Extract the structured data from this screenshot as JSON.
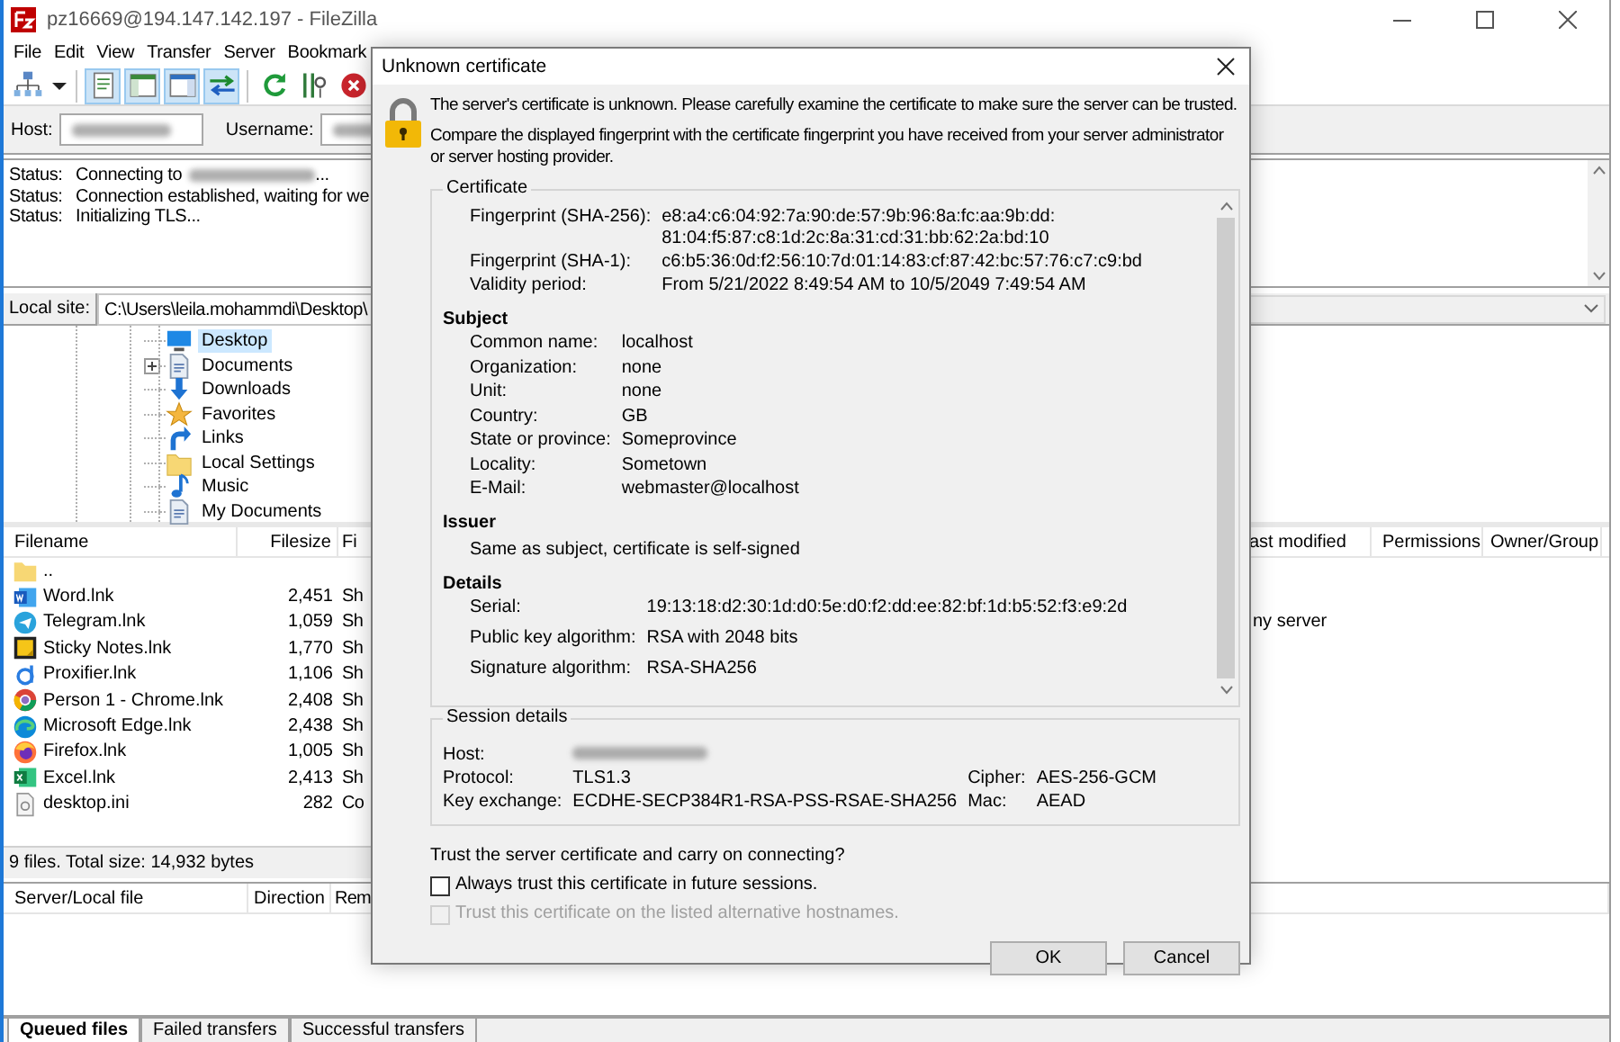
{
  "window": {
    "title": "pz16669@194.147.142.197 - FileZilla"
  },
  "menu": [
    "File",
    "Edit",
    "View",
    "Transfer",
    "Server",
    "Bookmark"
  ],
  "toolbar": [
    {
      "kind": "site-manager",
      "pressed": false
    },
    {
      "kind": "dropdown",
      "pressed": false
    },
    {
      "kind": "message-log",
      "pressed": true
    },
    {
      "kind": "local-tree",
      "pressed": true
    },
    {
      "kind": "remote-tree",
      "pressed": true
    },
    {
      "kind": "transfer-queue",
      "pressed": true
    },
    {
      "kind": "refresh",
      "pressed": false
    },
    {
      "kind": "filter",
      "pressed": false
    },
    {
      "kind": "cancel",
      "pressed": false
    }
  ],
  "quickconnect": {
    "host_label": "Host:",
    "host_redacted": true,
    "username_label": "Username:",
    "username_redacted": true
  },
  "log": [
    {
      "label": "Status:",
      "text": "Connecting to",
      "redacted": true,
      "after": "..."
    },
    {
      "label": "Status:",
      "text": "Connection established, waiting for we",
      "redacted": false
    },
    {
      "label": "Status:",
      "text": "Initializing TLS...",
      "redacted": false
    }
  ],
  "local": {
    "site_label": "Local site:",
    "path": "C:\\Users\\leila.mohammdi\\Desktop\\",
    "tree": [
      {
        "label": "Desktop",
        "kind": "desktop",
        "selected": true,
        "expandable": false
      },
      {
        "label": "Documents",
        "kind": "documents",
        "selected": false,
        "expandable": true
      },
      {
        "label": "Downloads",
        "kind": "downloads",
        "selected": false,
        "expandable": false
      },
      {
        "label": "Favorites",
        "kind": "favorites",
        "selected": false,
        "expandable": false
      },
      {
        "label": "Links",
        "kind": "links",
        "selected": false,
        "expandable": false
      },
      {
        "label": "Local Settings",
        "kind": "folder",
        "selected": false,
        "expandable": false
      },
      {
        "label": "Music",
        "kind": "music",
        "selected": false,
        "expandable": false
      },
      {
        "label": "My Documents",
        "kind": "documents",
        "selected": false,
        "expandable": false
      }
    ],
    "columns": [
      "Filename",
      "Filesize",
      "Fi"
    ],
    "files": [
      {
        "name": "..",
        "kind": "folder"
      },
      {
        "name": "Word.lnk",
        "size": "2,451",
        "type": "Sh",
        "kind": "word"
      },
      {
        "name": "Telegram.lnk",
        "size": "1,059",
        "type": "Sh",
        "kind": "telegram"
      },
      {
        "name": "Sticky Notes.lnk",
        "size": "1,770",
        "type": "Sh",
        "kind": "sticky"
      },
      {
        "name": "Proxifier.lnk",
        "size": "1,106",
        "type": "Sh",
        "kind": "proxifier"
      },
      {
        "name": "Person 1 - Chrome.lnk",
        "size": "2,408",
        "type": "Sh",
        "kind": "chrome"
      },
      {
        "name": "Microsoft Edge.lnk",
        "size": "2,438",
        "type": "Sh",
        "kind": "edge"
      },
      {
        "name": "Firefox.lnk",
        "size": "1,005",
        "type": "Sh",
        "kind": "firefox"
      },
      {
        "name": "Excel.lnk",
        "size": "2,413",
        "type": "Sh",
        "kind": "excel"
      },
      {
        "name": "desktop.ini",
        "size": "282",
        "type": "Co",
        "kind": "ini"
      }
    ],
    "summary": "9 files. Total size: 14,932 bytes"
  },
  "remote": {
    "columns": [
      "ast modified",
      "Permissions",
      "Owner/Group"
    ],
    "message": "ny server"
  },
  "queue": {
    "columns": [
      "Server/Local file",
      "Direction",
      "Rem"
    ],
    "tabs": [
      {
        "label": "Queued files",
        "selected": true
      },
      {
        "label": "Failed transfers",
        "selected": false
      },
      {
        "label": "Successful transfers",
        "selected": false
      }
    ]
  },
  "dialog": {
    "title": "Unknown certificate",
    "intro": [
      "The server's certificate is unknown. Please carefully examine the certificate to make sure the server can be trusted.",
      "Compare the displayed fingerprint with the certificate fingerprint you have received from your server administrator or server hosting provider."
    ],
    "certificate": {
      "legend": "Certificate",
      "fields": [
        {
          "label": "Fingerprint (SHA-256):",
          "lines": [
            "e8:a4:c6:04:92:7a:90:de:57:9b:96:8a:fc:aa:9b:dd:",
            "81:04:f5:87:c8:1d:2c:8a:31:cd:31:bb:62:2a:bd:10"
          ]
        },
        {
          "label": "Fingerprint (SHA-1):",
          "lines": [
            "c6:b5:36:0d:f2:56:10:7d:01:14:83:cf:87:42:bc:57:76:c7:c9:bd"
          ]
        },
        {
          "label": "Validity period:",
          "lines": [
            "From 5/21/2022 8:49:54 AM to 10/5/2049 7:49:54 AM"
          ]
        }
      ],
      "sections": [
        {
          "heading": "Subject",
          "fields": [
            {
              "label": "Common name:",
              "lines": [
                "localhost"
              ]
            },
            {
              "label": "Organization:",
              "lines": [
                "none"
              ]
            },
            {
              "label": "Unit:",
              "lines": [
                "none"
              ]
            },
            {
              "label": "Country:",
              "lines": [
                "GB"
              ]
            },
            {
              "label": "State or province:",
              "lines": [
                "Someprovince"
              ]
            },
            {
              "label": "Locality:",
              "lines": [
                "Sometown"
              ]
            },
            {
              "label": "E-Mail:",
              "lines": [
                "webmaster@localhost"
              ]
            }
          ]
        },
        {
          "heading": "Issuer",
          "text": "Same as subject, certificate is self-signed"
        },
        {
          "heading": "Details",
          "fields": [
            {
              "label": "Serial:",
              "lines": [
                "19:13:18:d2:30:1d:d0:5e:d0:f2:dd:ee:82:bf:1d:b5:52:f3:e9:2d"
              ]
            },
            {
              "label": "Public key algorithm:",
              "lines": [
                "RSA with 2048 bits"
              ]
            },
            {
              "label": "Signature algorithm:",
              "lines": [
                "RSA-SHA256"
              ]
            }
          ]
        }
      ]
    },
    "session": {
      "legend": "Session details",
      "host_label": "Host:",
      "host_redacted": true,
      "protocol_label": "Protocol:",
      "protocol": "TLS1.3",
      "cipher_label": "Cipher:",
      "cipher": "AES-256-GCM",
      "kex_label": "Key exchange:",
      "kex": "ECDHE-SECP384R1-RSA-PSS-RSAE-SHA256",
      "mac_label": "Mac:",
      "mac": "AEAD"
    },
    "question": "Trust the server certificate and carry on connecting?",
    "checkboxes": [
      {
        "label": "Always trust this certificate in future sessions.",
        "checked": false,
        "disabled": false
      },
      {
        "label": "Trust this certificate on the listed alternative hostnames.",
        "checked": false,
        "disabled": true
      }
    ],
    "buttons": [
      "OK",
      "Cancel"
    ]
  }
}
